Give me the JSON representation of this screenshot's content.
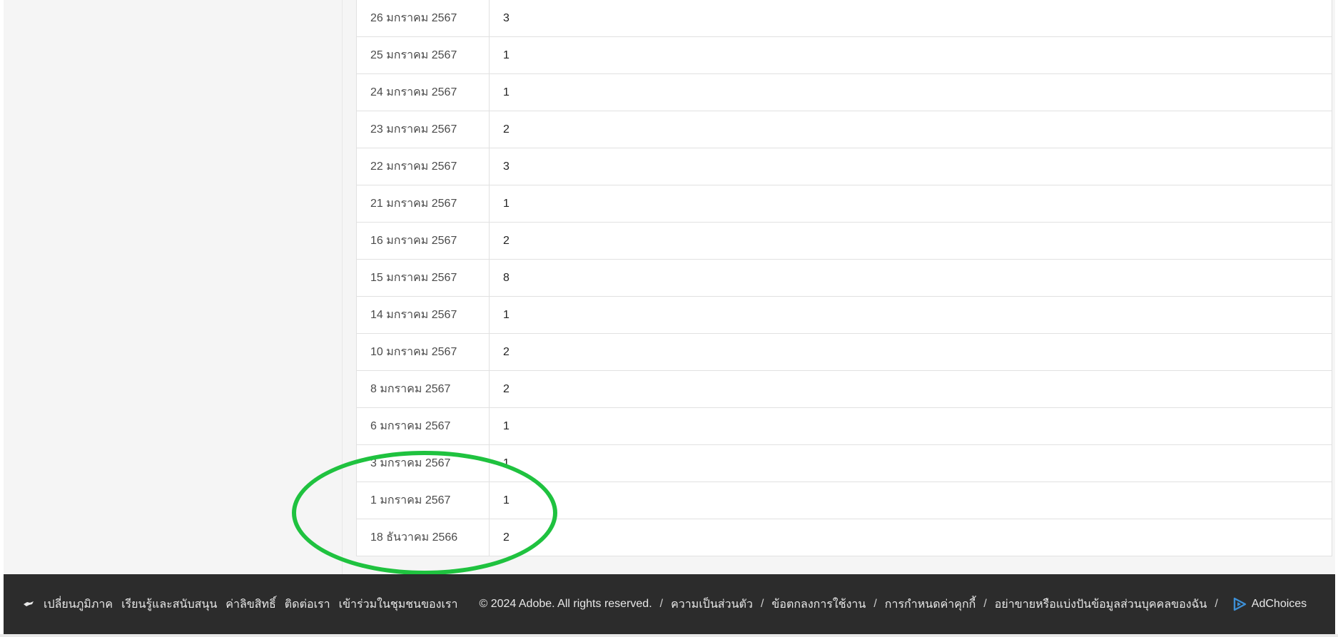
{
  "table": {
    "rows": [
      {
        "date": "26 มกราคม 2567",
        "count": "3"
      },
      {
        "date": "25 มกราคม 2567",
        "count": "1"
      },
      {
        "date": "24 มกราคม 2567",
        "count": "1"
      },
      {
        "date": "23 มกราคม 2567",
        "count": "2"
      },
      {
        "date": "22 มกราคม 2567",
        "count": "3"
      },
      {
        "date": "21 มกราคม 2567",
        "count": "1"
      },
      {
        "date": "16 มกราคม 2567",
        "count": "2"
      },
      {
        "date": "15 มกราคม 2567",
        "count": "8"
      },
      {
        "date": "14 มกราคม 2567",
        "count": "1"
      },
      {
        "date": "10 มกราคม 2567",
        "count": "2"
      },
      {
        "date": "8 มกราคม 2567",
        "count": "2"
      },
      {
        "date": "6 มกราคม 2567",
        "count": "1"
      },
      {
        "date": "3 มกราคม 2567",
        "count": "1"
      },
      {
        "date": "1 มกราคม 2567",
        "count": "1"
      },
      {
        "date": "18 ธันวาคม 2566",
        "count": "2"
      }
    ]
  },
  "footer": {
    "change_region": "เปลี่ยนภูมิภาค",
    "learn_support": "เรียนรู้และสนับสนุน",
    "royalties": "ค่าลิขสิทธิ์",
    "contact": "ติดต่อเรา",
    "community": "เข้าร่วมในชุมชนของเรา",
    "copyright": "© 2024 Adobe. All rights reserved.",
    "privacy": "ความเป็นส่วนตัว",
    "terms": "ข้อตกลงการใช้งาน",
    "cookies": "การกำหนดค่าคุกกี้",
    "do_not_sell": "อย่าขายหรือแบ่งปันข้อมูลส่วนบุคคลของฉัน",
    "adchoices": "AdChoices",
    "separator": "/"
  },
  "colors": {
    "annotation": "#1fc23f",
    "footer_bg": "#2c2c2c",
    "adchoices_icon": "#3d8fd6"
  },
  "icons": {
    "region": "globe-icon",
    "adchoices": "adchoices-triangle-icon"
  }
}
